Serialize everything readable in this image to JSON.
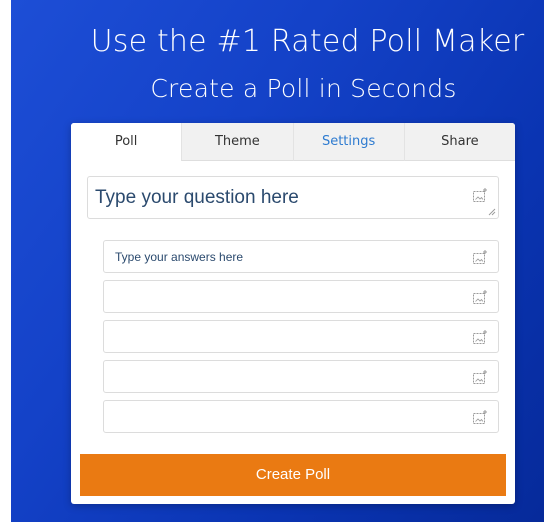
{
  "hero": {
    "headline": "Use the #1 Rated Poll Maker",
    "subheadline": "Create a Poll in Seconds"
  },
  "tabs": [
    {
      "label": "Poll",
      "active": true
    },
    {
      "label": "Theme",
      "active": false
    },
    {
      "label": "Settings",
      "active": false
    },
    {
      "label": "Share",
      "active": false
    }
  ],
  "question": {
    "placeholder": "Type your question here",
    "icon": "add-image-icon"
  },
  "answers": [
    {
      "placeholder": "Type your answers here",
      "icon": "add-image-icon"
    },
    {
      "placeholder": "",
      "icon": "add-image-icon"
    },
    {
      "placeholder": "",
      "icon": "add-image-icon"
    },
    {
      "placeholder": "",
      "icon": "add-image-icon"
    },
    {
      "placeholder": "",
      "icon": "add-image-icon"
    }
  ],
  "actions": {
    "create_label": "Create Poll"
  },
  "colors": {
    "hero_bg": "#1442c8",
    "button_bg": "#ea7a12",
    "settings_link": "#2e7bd0",
    "tab_bg": "#f1f1f1"
  }
}
